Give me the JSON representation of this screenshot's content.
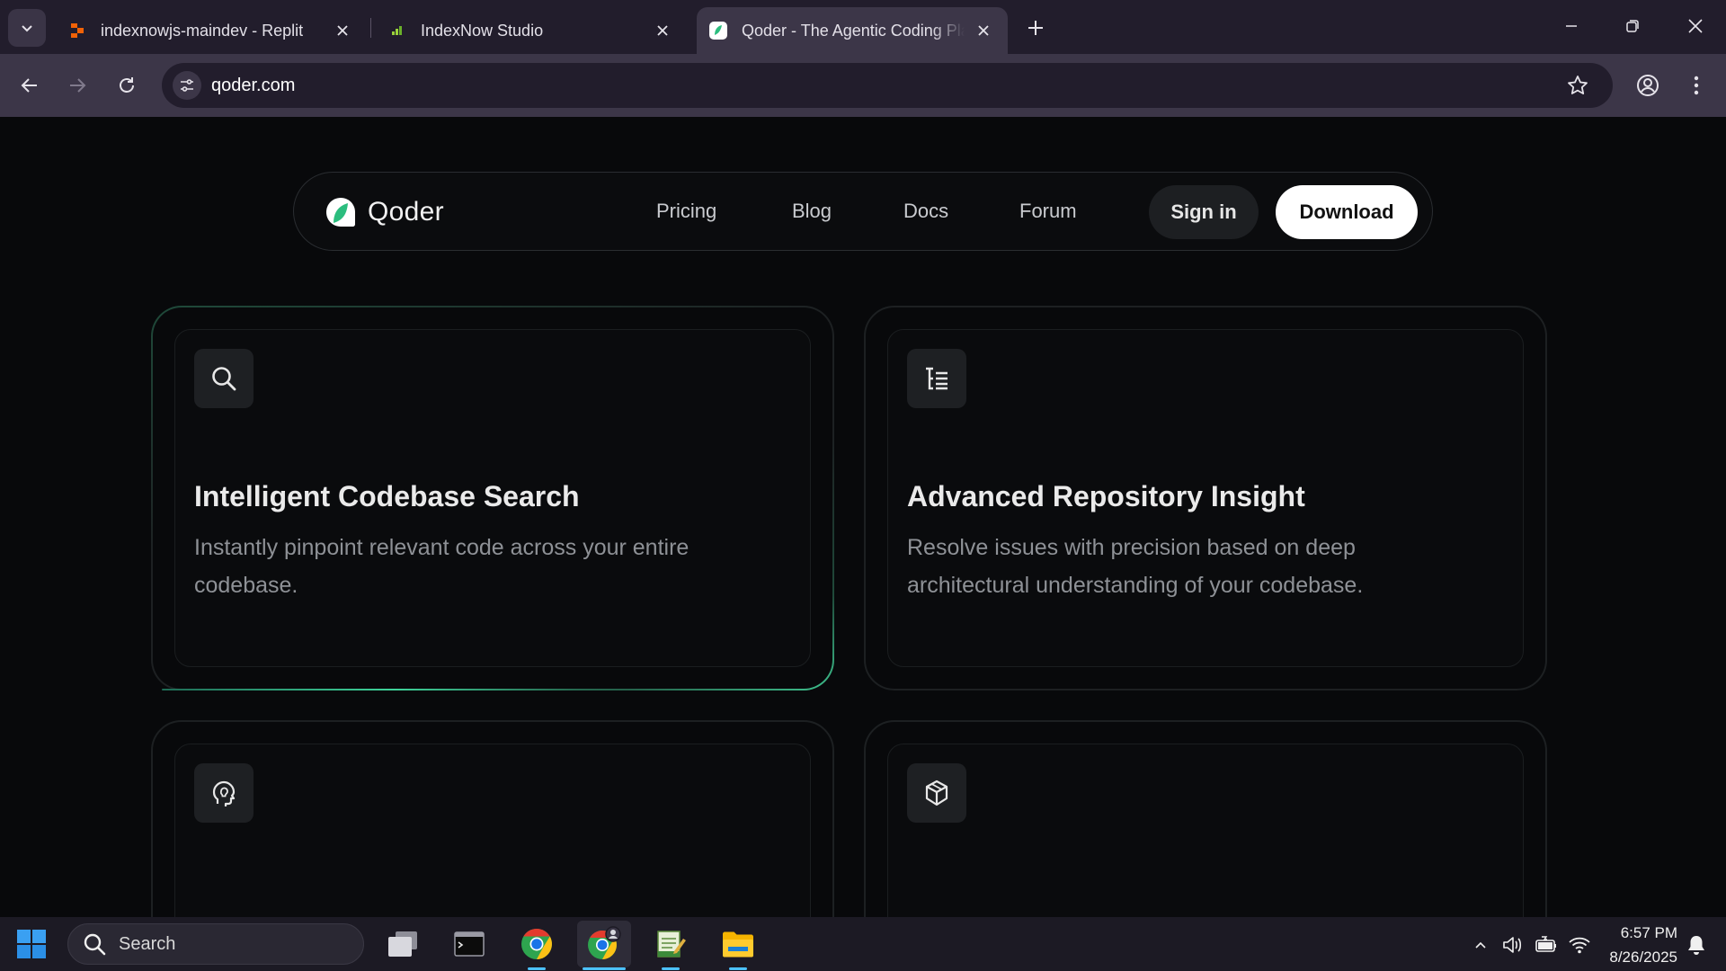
{
  "browser": {
    "tabs": [
      {
        "title": "indexnowjs-maindev - Replit",
        "favicon": "replit-icon",
        "active": false
      },
      {
        "title": "IndexNow Studio",
        "favicon": "indexnow-icon",
        "active": false
      },
      {
        "title": "Qoder - The Agentic Coding Platform",
        "favicon": "qoder-icon",
        "active": true
      }
    ],
    "url": "qoder.com"
  },
  "site": {
    "brand": "Qoder",
    "nav": {
      "links": [
        "Pricing",
        "Blog",
        "Docs",
        "Forum"
      ],
      "sign_in": "Sign in",
      "download": "Download"
    },
    "features": [
      {
        "icon": "search-icon",
        "title": "Intelligent Codebase Search",
        "description": "Instantly pinpoint relevant code across your entire codebase."
      },
      {
        "icon": "list-tree-icon",
        "title": "Advanced Repository Insight",
        "description": "Resolve issues with precision based on deep architectural understanding of your codebase."
      },
      {
        "icon": "head-bulb-icon",
        "title": "",
        "description": ""
      },
      {
        "icon": "cube-icon",
        "title": "",
        "description": ""
      }
    ],
    "colors": {
      "accent": "#3ed39a",
      "background": "#08090b"
    }
  },
  "taskbar": {
    "search_placeholder": "Search",
    "time": "6:57 PM",
    "date": "8/26/2025"
  }
}
